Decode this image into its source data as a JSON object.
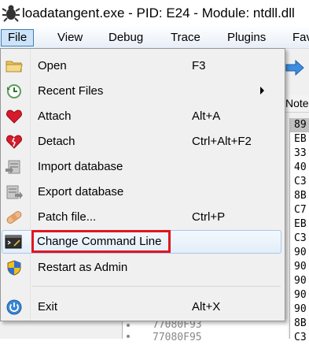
{
  "window": {
    "title": "loadatangent.exe - PID: E24 - Module: ntdll.dll",
    "app_icon": "bug-icon"
  },
  "menubar": {
    "items": [
      "File",
      "View",
      "Debug",
      "Trace",
      "Plugins",
      "Fav"
    ],
    "active": "File"
  },
  "background": {
    "notes_header": "Notes",
    "hex_bytes": [
      "89",
      "EB",
      "33",
      "40",
      "C3",
      "8B",
      "C7",
      "EB",
      "C3",
      "90",
      "90",
      "90",
      "90",
      "90",
      "8B",
      "C3"
    ],
    "addresses": [
      "77080F93",
      "77080F95"
    ]
  },
  "file_menu": {
    "items": [
      {
        "label": "Open",
        "shortcut": "F3",
        "icon": "folder-icon"
      },
      {
        "label": "Recent Files",
        "shortcut": "",
        "icon": "recent-files-icon",
        "submenu": true
      },
      {
        "label": "Attach",
        "shortcut": "Alt+A",
        "icon": "heart-icon"
      },
      {
        "label": "Detach",
        "shortcut": "Ctrl+Alt+F2",
        "icon": "broken-heart-icon"
      },
      {
        "label": "Import database",
        "shortcut": "",
        "icon": "import-database-icon"
      },
      {
        "label": "Export database",
        "shortcut": "",
        "icon": "export-database-icon"
      },
      {
        "label": "Patch file...",
        "shortcut": "Ctrl+P",
        "icon": "bandage-icon"
      },
      {
        "label": "Change Command Line",
        "shortcut": "",
        "icon": "terminal-icon"
      },
      {
        "label": "Restart as Admin",
        "shortcut": "",
        "icon": "shield-icon"
      },
      {
        "label": "Exit",
        "shortcut": "Alt+X",
        "icon": "power-icon"
      }
    ],
    "hovered": "Change Command Line"
  },
  "colors": {
    "highlight_box": "#e0161f",
    "menu_active_bg": "#cde3f9",
    "menu_bg": "#f0f0f0"
  }
}
